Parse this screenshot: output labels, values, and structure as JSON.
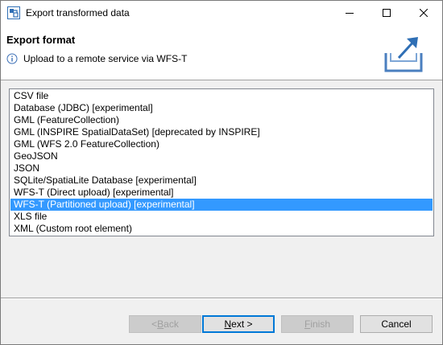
{
  "window": {
    "title": "Export transformed data"
  },
  "header": {
    "title": "Export format",
    "message": "Upload to a remote service via WFS-T"
  },
  "formats": [
    {
      "label": "CSV file",
      "selected": false
    },
    {
      "label": "Database (JDBC) [experimental]",
      "selected": false
    },
    {
      "label": "GML (FeatureCollection)",
      "selected": false
    },
    {
      "label": "GML (INSPIRE SpatialDataSet) [deprecated by INSPIRE]",
      "selected": false
    },
    {
      "label": "GML (WFS 2.0 FeatureCollection)",
      "selected": false
    },
    {
      "label": "GeoJSON",
      "selected": false
    },
    {
      "label": "JSON",
      "selected": false
    },
    {
      "label": "SQLite/SpatiaLite Database [experimental]",
      "selected": false
    },
    {
      "label": "WFS-T (Direct upload) [experimental]",
      "selected": false
    },
    {
      "label": "WFS-T (Partitioned upload) [experimental]",
      "selected": true
    },
    {
      "label": "XLS file",
      "selected": false
    },
    {
      "label": "XML (Custom root element)",
      "selected": false
    }
  ],
  "buttons": {
    "back": {
      "prefix": "< ",
      "mnemonic": "B",
      "rest": "ack",
      "enabled": false
    },
    "next": {
      "prefix": "",
      "mnemonic": "N",
      "rest": "ext >",
      "enabled": true
    },
    "finish": {
      "prefix": "",
      "mnemonic": "F",
      "rest": "inish",
      "enabled": false
    },
    "cancel": {
      "label": "Cancel",
      "enabled": true
    }
  },
  "colors": {
    "selection": "#3399ff",
    "accent": "#0078d7"
  },
  "icons": {
    "app": "app-transform-icon",
    "info": "info-icon",
    "export": "export-tray-icon"
  }
}
